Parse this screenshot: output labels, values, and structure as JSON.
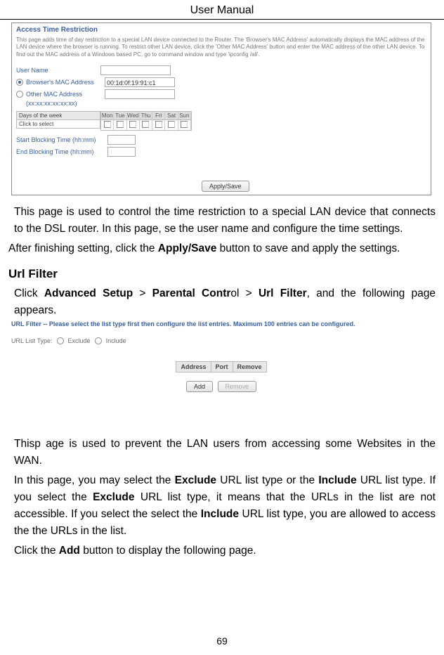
{
  "header": {
    "title": "User Manual"
  },
  "screenshot1": {
    "title": "Access Time Restriction",
    "description": "This page adds time of day restriction to a special LAN device connected to the Router. The 'Browser's MAC Address' automatically displays the MAC address of the LAN device where the browser is running. To restrict other LAN device, click the 'Other MAC Address' button and enter the MAC address of the other LAN device. To find out the MAC address of a Windows based PC, go to command window and type 'ipconfig /all'.",
    "userNameLabel": "User Name",
    "browserMacLabel": "Browser's MAC Address",
    "browserMacValue": "00:1d:0f:19:91:c1",
    "otherMacLabel": "Other MAC Address",
    "otherMacHint": "(xx:xx:xx:xx:xx:xx)",
    "daysLabel": "Days of the week",
    "clickSelect": "Click to select",
    "days": [
      "Mon",
      "Tue",
      "Wed",
      "Thu",
      "Fri",
      "Sat",
      "Sun"
    ],
    "startLabel": "Start Blocking Time (hh:mm)",
    "endLabel": "End Blocking Time (hh:mm)",
    "applyBtn": "Apply/Save"
  },
  "para1": "This page is used to control the time restriction to a special LAN device that connects to the DSL router. In this page, se the user name and configure the time settings.",
  "para2a": "After finishing setting, click the ",
  "para2b": "Apply/Save",
  "para2c": " button to save and apply the settings.",
  "sectionHeading": "Url Filter",
  "para3a": "Click ",
  "para3b": "Advanced Setup",
  "para3c": " > ",
  "para3d": "Parental Contr",
  "para3e": "ol > ",
  "para3f": "Url Filter",
  "para3g": ", and the following page appears.",
  "screenshot2": {
    "title": "URL Filter -- Please select the list type first then configure the list entries. Maximum 100 entries can be configured.",
    "listTypeLabel": "URL List Type:",
    "excludeLabel": "Exclude",
    "includeLabel": "Include",
    "th1": "Address",
    "th2": "Port",
    "th3": "Remove",
    "addBtn": "Add",
    "removeBtn": "Remove"
  },
  "para4": "Thisp age is used to prevent the LAN users from accessing some Websites in the WAN.",
  "para5a": "In this page, you may select the ",
  "para5b": "Exclude",
  "para5c": " URL list type or the ",
  "para5d": "Include",
  "para5e": " URL list type. If you select the ",
  "para5f": "Exclude",
  "para5g": " URL list type, it means that the URLs in the list are not accessible. If you select the select the ",
  "para5h": "Include",
  "para5i": " URL list type, you are allowed to access the the URLs in the list.",
  "para6a": "Click the ",
  "para6b": "Add",
  "para6c": " button to display the following page.",
  "pageNumber": "69"
}
